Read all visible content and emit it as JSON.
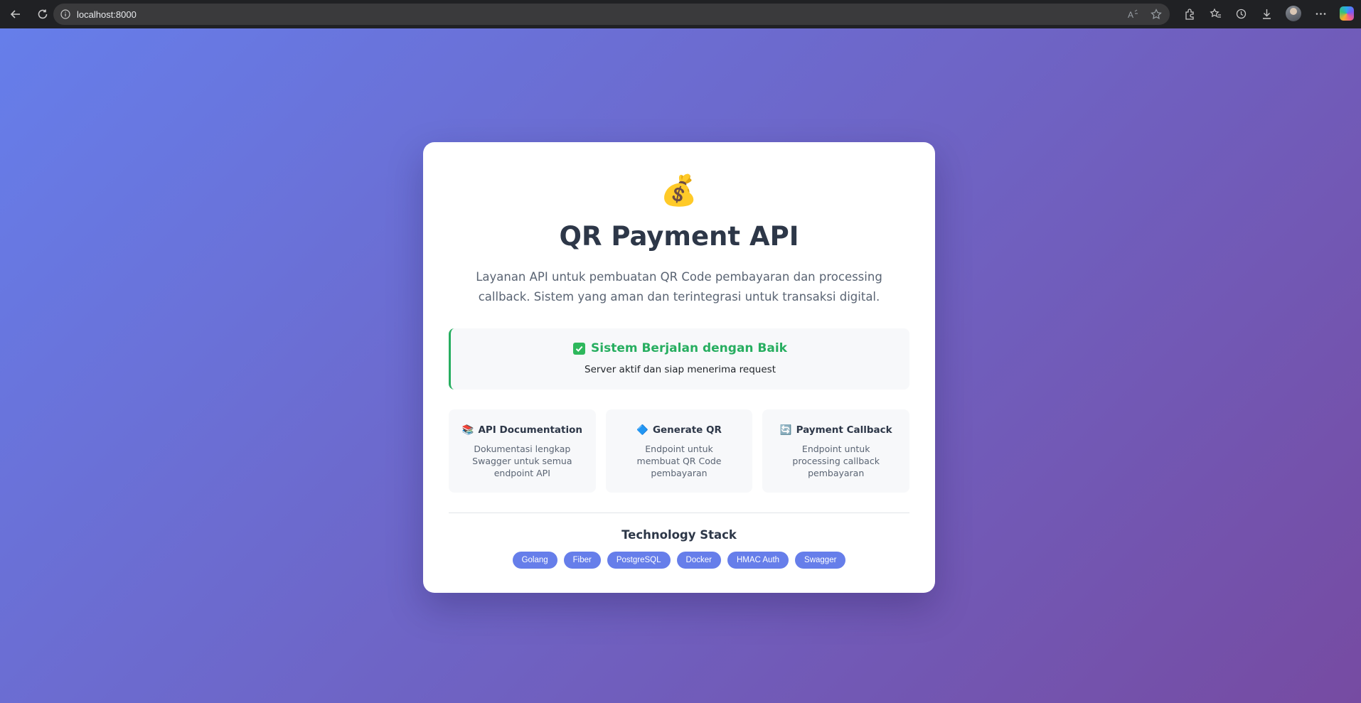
{
  "browser": {
    "url": "localhost:8000",
    "icons": {
      "back": "back-arrow-icon",
      "reload": "reload-icon",
      "info": "info-icon",
      "read_aloud": "read-aloud-icon",
      "favorite": "star-icon",
      "extensions": "extensions-icon",
      "favorites": "favorites-icon",
      "history": "history-icon",
      "downloads": "download-icon",
      "profile": "avatar",
      "more": "more-icon",
      "copilot": "copilot-icon"
    }
  },
  "page": {
    "logo": "💰",
    "title": "QR Payment API",
    "description": "Layanan API untuk pembuatan QR Code pembayaran dan processing callback. Sistem yang aman dan terintegrasi untuk transaksi digital.",
    "status": {
      "title": "Sistem Berjalan dengan Baik",
      "text": "Server aktif dan siap menerima request",
      "color": "#27ae60"
    },
    "features": [
      {
        "icon": "📚",
        "title": "API Documentation",
        "description": "Dokumentasi lengkap Swagger untuk semua endpoint API"
      },
      {
        "icon": "🔷",
        "title": "Generate QR",
        "description": "Endpoint untuk membuat QR Code pembayaran"
      },
      {
        "icon": "🔄",
        "title": "Payment Callback",
        "description": "Endpoint untuk processing callback pembayaran"
      }
    ],
    "tech_stack": {
      "title": "Technology Stack",
      "items": [
        "Golang",
        "Fiber",
        "PostgreSQL",
        "Docker",
        "HMAC Auth",
        "Swagger"
      ]
    },
    "colors": {
      "gradient_start": "#667eea",
      "gradient_end": "#764ba2",
      "badge": "#667eea"
    }
  }
}
